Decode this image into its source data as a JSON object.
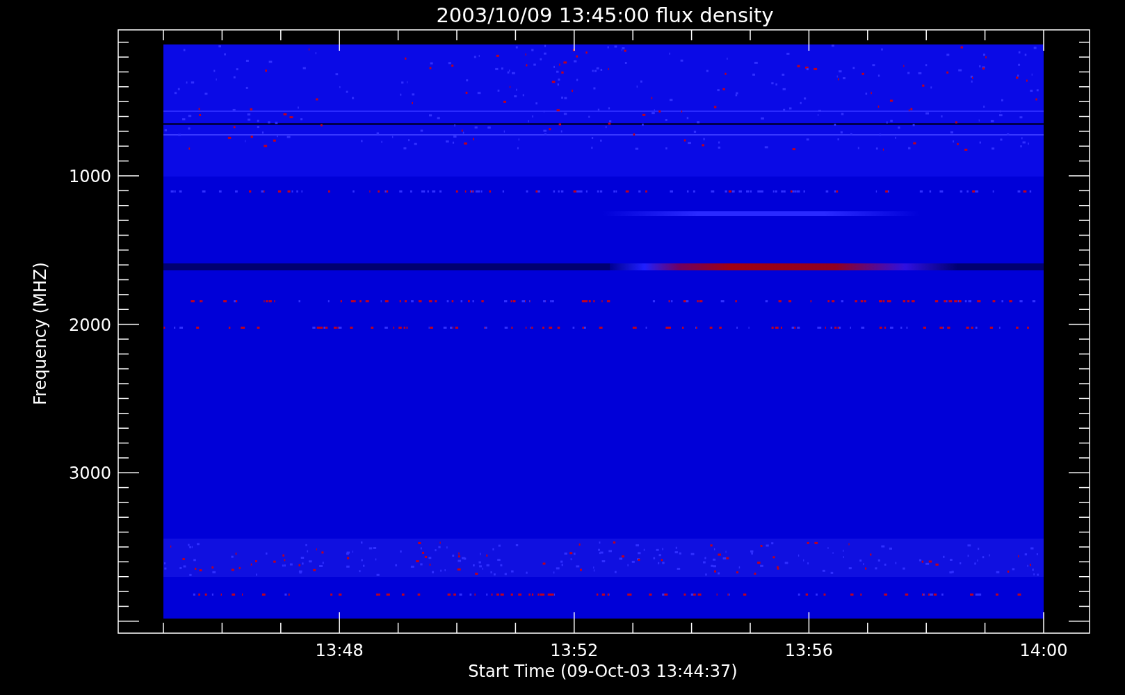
{
  "title": "2003/10/09 13:45:00 flux density",
  "y_axis": {
    "label": "Frequency (MHZ)",
    "ticks": [
      "1000",
      "2000",
      "3000"
    ]
  },
  "x_axis": {
    "label": "Start Time (09-Oct-03 13:44:37)",
    "ticks": [
      "13:48",
      "13:52",
      "13:56",
      "14:00"
    ]
  }
}
